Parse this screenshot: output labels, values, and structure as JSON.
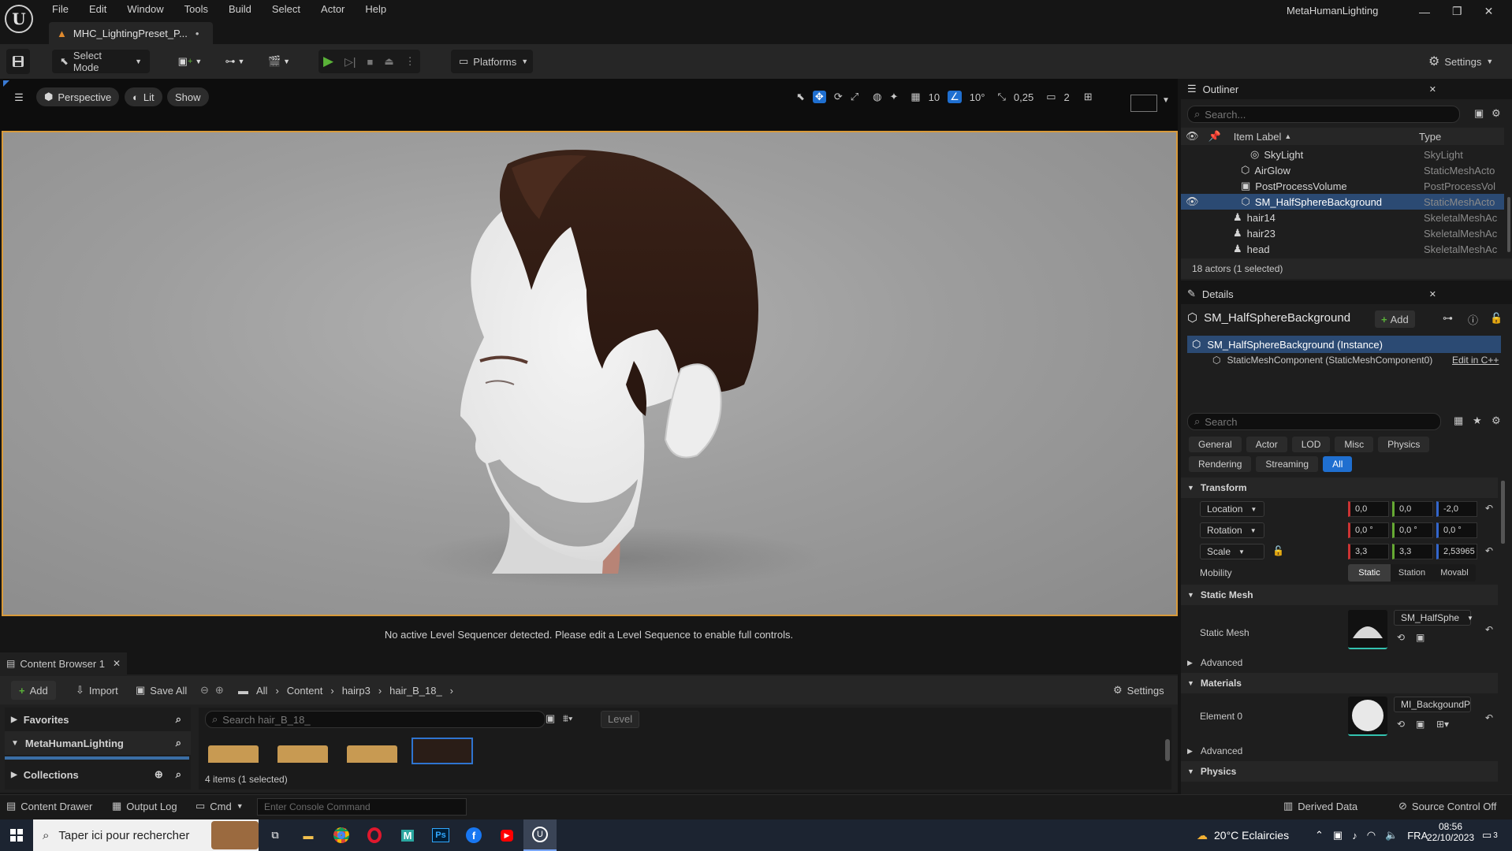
{
  "menu": [
    "File",
    "Edit",
    "Window",
    "Tools",
    "Build",
    "Select",
    "Actor",
    "Help"
  ],
  "window_title": "MetaHumanLighting",
  "doc_tab": "MHC_LightingPreset_P...",
  "toolbar": {
    "mode": "Select Mode",
    "platforms": "Platforms",
    "settings": "Settings"
  },
  "viewport": {
    "perspective": "Perspective",
    "lit": "Lit",
    "show": "Show",
    "grid_snap": "10",
    "angle_snap": "10°",
    "scale_snap": "0,25",
    "camera_speed": "2",
    "status": "No active Level Sequencer detected. Please edit a Level Sequence to enable full controls."
  },
  "content_browser": {
    "tab": "Content Browser 1",
    "add": "Add",
    "import": "Import",
    "save_all": "Save All",
    "breadcrumb": [
      "All",
      "Content",
      "hairp3",
      "hair_B_18_"
    ],
    "settings": "Settings",
    "favorites": "Favorites",
    "project": "MetaHumanLighting",
    "collections": "Collections",
    "search_placeholder": "Search hair_B_18_",
    "filter_chip": "Level",
    "count": "4 items (1 selected)"
  },
  "bottom": {
    "content_drawer": "Content Drawer",
    "output_log": "Output Log",
    "cmd": "Cmd",
    "console_placeholder": "Enter Console Command",
    "derived_data": "Derived Data",
    "source_control": "Source Control Off"
  },
  "outliner": {
    "title": "Outliner",
    "search_placeholder": "Search...",
    "col_label": "Item Label",
    "col_type": "Type",
    "rows": [
      {
        "label": "SkyLight",
        "type": "SkyLight"
      },
      {
        "label": "AirGlow",
        "type": "StaticMeshActo"
      },
      {
        "label": "PostProcessVolume",
        "type": "PostProcessVol"
      },
      {
        "label": "SM_HalfSphereBackground",
        "type": "StaticMeshActo"
      },
      {
        "label": "hair14",
        "type": "SkeletalMeshAc"
      },
      {
        "label": "hair23",
        "type": "SkeletalMeshAc"
      },
      {
        "label": "head",
        "type": "SkeletalMeshAc"
      }
    ],
    "status": "18 actors (1 selected)"
  },
  "details": {
    "title": "Details",
    "object": "SM_HalfSphereBackground",
    "add": "Add",
    "instance": "SM_HalfSphereBackground (Instance)",
    "component": "StaticMeshComponent (StaticMeshComponent0)",
    "edit_cpp": "Edit in C++",
    "search_placeholder": "Search",
    "filters": [
      "General",
      "Actor",
      "LOD",
      "Misc",
      "Physics",
      "Rendering",
      "Streaming",
      "All"
    ],
    "transform": "Transform",
    "location_label": "Location",
    "location": [
      "0,0",
      "0,0",
      "-2,0"
    ],
    "rotation_label": "Rotation",
    "rotation": [
      "0,0 °",
      "0,0 °",
      "0,0 °"
    ],
    "scale_label": "Scale",
    "scale": [
      "3,3",
      "3,3",
      "2,53965"
    ],
    "mobility_label": "Mobility",
    "mobility": [
      "Static",
      "Station",
      "Movabl"
    ],
    "static_mesh_section": "Static Mesh",
    "static_mesh_label": "Static Mesh",
    "static_mesh_value": "SM_HalfSphe",
    "advanced": "Advanced",
    "materials": "Materials",
    "element0": "Element 0",
    "material_value": "MI_BackgoundPlane",
    "physics": "Physics"
  },
  "taskbar": {
    "search_placeholder": "Taper ici pour rechercher",
    "weather": "20°C  Eclaircies",
    "lang": "FRA",
    "time": "08:56",
    "date": "22/10/2023",
    "notif": "3"
  },
  "colors": {
    "accent": "#1f6fd0",
    "selection": "#2b4a73",
    "viewport_border": "#d89a3a",
    "play": "#5ab238"
  }
}
